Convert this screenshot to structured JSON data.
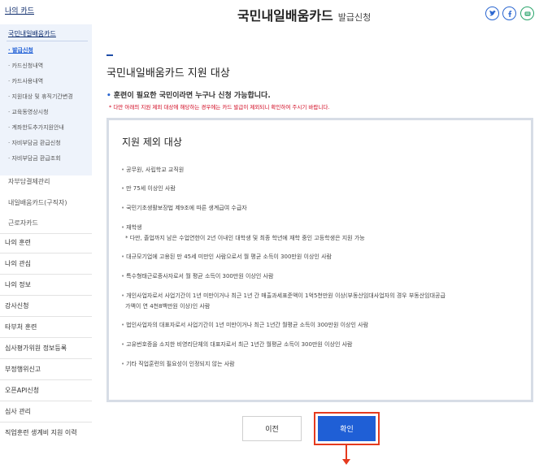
{
  "sidebar": {
    "top_link": "나의 카드",
    "submenu_title": "국민내일배움카드",
    "submenu_items": [
      {
        "label": "· 발급신청",
        "active": true
      },
      {
        "label": "· 카드신청내역"
      },
      {
        "label": "· 카드사용내역"
      },
      {
        "label": "· 지원대상 및 휴직기간변경"
      },
      {
        "label": "· 교육동영상시청"
      },
      {
        "label": "· 계좌한도추가지원안내"
      },
      {
        "label": "· 자비부담금 환급신청"
      },
      {
        "label": "· 자비부담금 환급조회"
      }
    ],
    "sub_links": [
      "자부담결제관리",
      "내일배움카드(구직자)",
      "근로자카드"
    ],
    "items": [
      "나의 훈련",
      "나의 관심",
      "나의 정보",
      "강사신청",
      "타부처 훈련",
      "심사평가위원 정보등록",
      "부정행위신고",
      "오픈API신청",
      "심사 관리",
      "직업훈련 생계비 지원 이력"
    ]
  },
  "header": {
    "title": "국민내일배움카드",
    "subtitle": "발급신청",
    "social_icons": [
      "twitter-icon",
      "facebook-icon",
      "kakao-icon"
    ]
  },
  "main": {
    "heading": "국민내일배움카드 지원 대상",
    "intro": "훈련이 필요한 국민이라면 누구나 신청 가능합니다.",
    "intro_bullet": "•",
    "notice": "* 다만 아래의 지원 제외 대상에 해당하는 경우에는 카드 발급이 제외되니 확인하여 주시기 바랍니다."
  },
  "box": {
    "title": "지원 제외 대상",
    "bullet": "•",
    "items": [
      "공무원, 사립학교 교직원",
      "만 75세 이상인 사람",
      "국민기초생활보장법 제9조에 따른 생계급여 수급자",
      "재학생",
      "대규모기업에 고용된 만 45세 미만인 사람으로서 월 평균 소득이 300만원 이상인 사람",
      "특수형태근로종사자로서 월 평균 소득이 300만원 이상인 사람",
      "개인사업자로서 사업기간이 1년 미만이거나 최근 1년 간 매출과세표준액이 1억5천만원 이상(부동산임대사업자의 경우 부동산임대공급",
      "법인사업자의 대표자로서 사업기간이 1년 미만이거나 최근 1년간 월평균 소득이 300만원 이상인 사람",
      "고유번호증을 소지한 비영리단체의 대표자로서 최근 1년간 월평균 소득이 300만원 이상인 사람",
      "기타 직업훈련의 필요성이 인정되지 않는 사람"
    ],
    "sub_item_student": "* 다만, 졸업까지 남은 수업연한이 2년 이내인 대학생 및 최종 학년에 재학 중인 고등학생은 지원 가능",
    "sub_item_business": "가액이 연 4천8백만원 이상)인 사람"
  },
  "buttons": {
    "prev": "이전",
    "confirm": "확인"
  },
  "colors": {
    "accent": "#1f5fd6",
    "highlight": "#e53a1e",
    "notice": "#d0021b"
  }
}
